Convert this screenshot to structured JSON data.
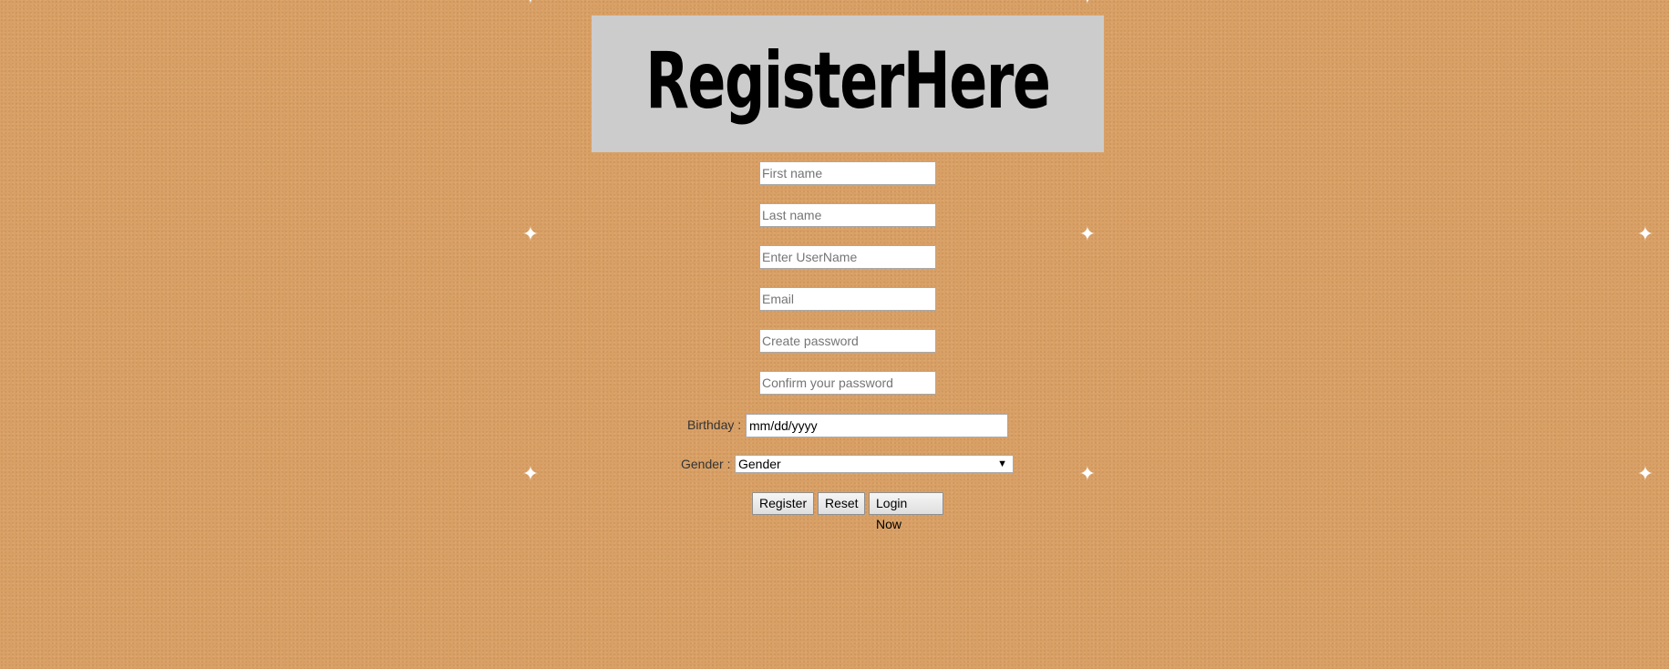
{
  "banner": {
    "title": "RegisterHere"
  },
  "form": {
    "first_name": {
      "placeholder": "First name",
      "value": ""
    },
    "last_name": {
      "placeholder": "Last name",
      "value": ""
    },
    "username": {
      "placeholder": "Enter UserName",
      "value": ""
    },
    "email": {
      "placeholder": "Email",
      "value": ""
    },
    "password": {
      "placeholder": "Create password",
      "value": ""
    },
    "confirm_password": {
      "placeholder": "Confirm your password",
      "value": ""
    },
    "birthday": {
      "label": "Birthday :",
      "value": "mm/dd/yyyy"
    },
    "gender": {
      "label": "Gender :",
      "selected": "Gender",
      "arrow": "▼"
    }
  },
  "buttons": {
    "register": "Register",
    "reset": "Reset",
    "login": "Login Now"
  },
  "decor": {
    "sparkle": "✦",
    "background_color": "#d9a066",
    "banner_color": "#cccccc"
  }
}
